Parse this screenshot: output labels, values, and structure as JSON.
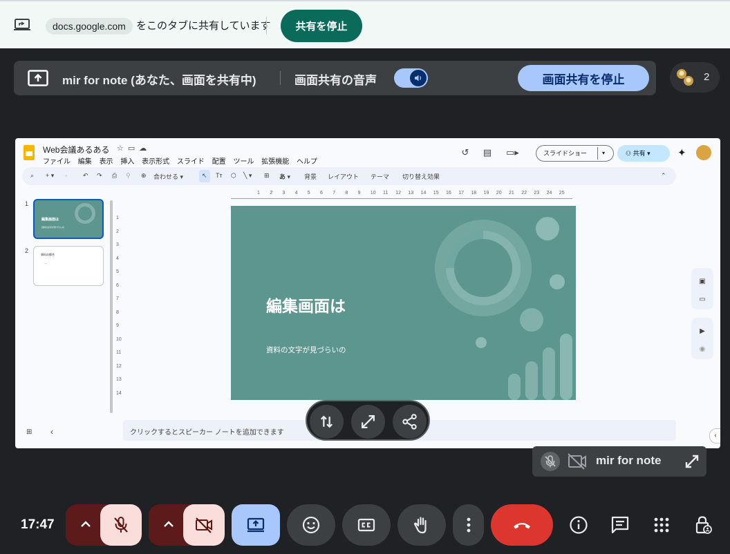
{
  "share_bar": {
    "domain": "docs.google.com",
    "message": "をこのタブに共有しています",
    "stop_label": "共有を停止"
  },
  "present_banner": {
    "label": "mir for note (あなた、画面を共有中)",
    "audio_label": "画面共有の音声",
    "audio_enabled": true,
    "stop_label": "画面共有を停止"
  },
  "participants": {
    "count": "2"
  },
  "slides_app": {
    "doc_title": "Web会議あるある",
    "menus": [
      "ファイル",
      "編集",
      "表示",
      "挿入",
      "表示形式",
      "スライド",
      "配置",
      "ツール",
      "拡張機能",
      "ヘルプ"
    ],
    "slideshow_label": "スライドショー",
    "share_label": "共有",
    "toolbar": {
      "zoom": "合わせる",
      "text_style": "あ",
      "background": "背景",
      "layout": "レイアウト",
      "theme": "テーマ",
      "transition": "切り替え効果"
    },
    "ruler_h": [
      "1",
      "2",
      "3",
      "4",
      "5",
      "6",
      "7",
      "8",
      "9",
      "10",
      "11",
      "12",
      "13",
      "14",
      "15",
      "16",
      "17",
      "18",
      "19",
      "20",
      "21",
      "22",
      "23",
      "24",
      "25"
    ],
    "ruler_v": [
      "1",
      "2",
      "3",
      "4",
      "5",
      "6",
      "7",
      "8",
      "9",
      "10",
      "11",
      "12",
      "13",
      "14"
    ],
    "thumbnails": [
      {
        "number": "1",
        "title": "編集画面は",
        "subtitle": "資料の文字が見づらいの"
      },
      {
        "number": "2",
        "title": "資料の都合",
        "subtitle": "—"
      }
    ],
    "slide": {
      "title": "編集画面は",
      "subtitle": "資料の文字が見づらいの",
      "background_color": "#5c968f"
    },
    "notes_placeholder": "クリックするとスピーカー ノートを追加できます"
  },
  "self_view": {
    "name": "mir for note"
  },
  "bottom_bar": {
    "time": "17:47",
    "mic_state": "off",
    "camera_state": "off",
    "colors": {
      "danger": "#dc362e",
      "accent": "#a8c7fa",
      "muted_bg": "#f9dedc"
    }
  }
}
